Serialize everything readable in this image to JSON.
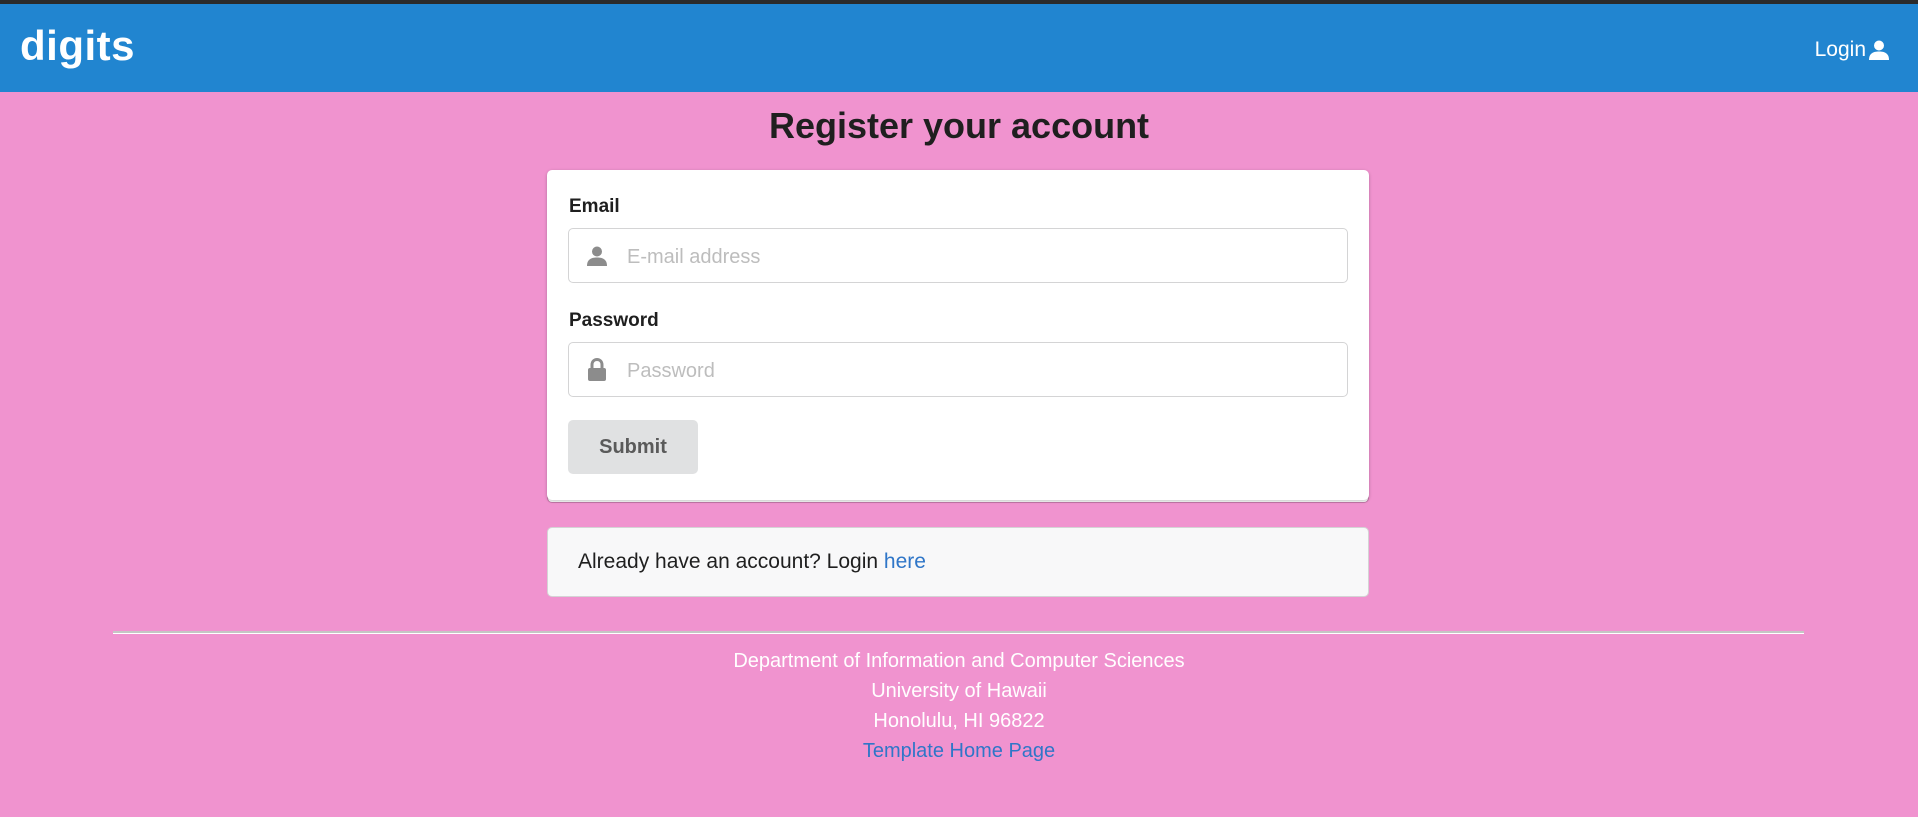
{
  "navbar": {
    "brand": "digits",
    "login_label": "Login",
    "login_icon": "user-icon",
    "color": "#2185d0"
  },
  "page": {
    "background": "#f093cf",
    "title": "Register your account"
  },
  "form": {
    "email": {
      "label": "Email",
      "placeholder": "E-mail address",
      "value": "",
      "icon": "user-icon"
    },
    "password": {
      "label": "Password",
      "placeholder": "Password",
      "value": "",
      "icon": "lock-icon"
    },
    "submit_label": "Submit"
  },
  "message": {
    "text": "Already have an account? Login ",
    "link_label": "here"
  },
  "footer": {
    "line1": "Department of Information and Computer Sciences",
    "line2": "University of Hawaii",
    "line3": "Honolulu, HI 96822",
    "link_label": "Template Home Page"
  }
}
